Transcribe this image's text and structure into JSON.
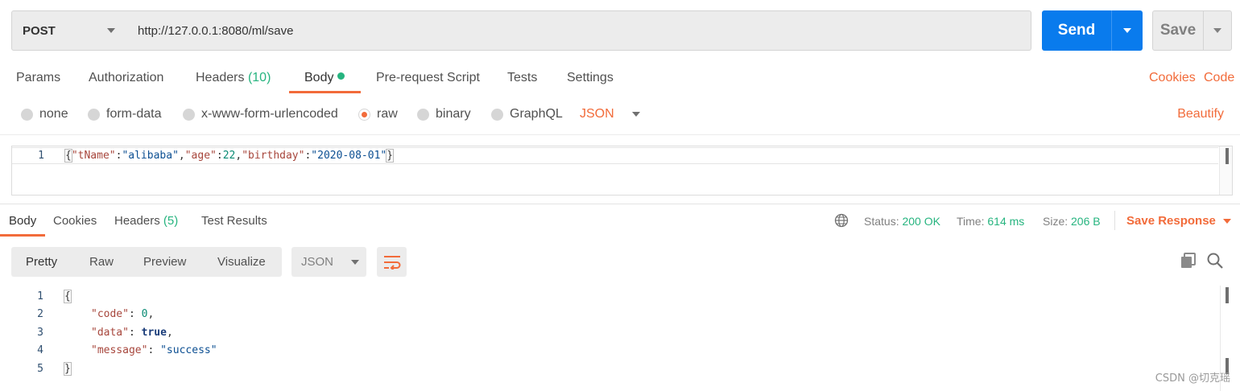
{
  "request": {
    "method": "POST",
    "url": "http://127.0.0.1:8080/ml/save",
    "send_label": "Send",
    "save_label": "Save"
  },
  "request_tabs": {
    "params": "Params",
    "authorization": "Authorization",
    "headers": "Headers",
    "headers_count": "(10)",
    "body": "Body",
    "pre_request": "Pre-request Script",
    "tests": "Tests",
    "settings": "Settings",
    "cookies": "Cookies",
    "code": "Code"
  },
  "body_types": {
    "none": "none",
    "form_data": "form-data",
    "urlencoded": "x-www-form-urlencoded",
    "raw": "raw",
    "binary": "binary",
    "graphql": "GraphQL",
    "selected": "raw",
    "language": "JSON",
    "beautify": "Beautify"
  },
  "request_body": {
    "line_number": "1",
    "tokens": {
      "open": "{",
      "k1": "\"tName\"",
      "c1": ":",
      "v1": "\"alibaba\"",
      "s1": ",",
      "k2": "\"age\"",
      "c2": ":",
      "v2": "22",
      "s2": ",",
      "k3": "\"birthday\"",
      "c3": ":",
      "v3": "\"2020-08-01\"",
      "close": "}"
    }
  },
  "response_tabs": {
    "body": "Body",
    "cookies": "Cookies",
    "headers": "Headers",
    "headers_count": "(5)",
    "test_results": "Test Results"
  },
  "response_meta": {
    "status_label": "Status:",
    "status_value": "200 OK",
    "time_label": "Time:",
    "time_value": "614 ms",
    "size_label": "Size:",
    "size_value": "206 B",
    "save_response": "Save Response"
  },
  "response_toolbar": {
    "pretty": "Pretty",
    "raw": "Raw",
    "preview": "Preview",
    "visualize": "Visualize",
    "format": "JSON"
  },
  "response_body": {
    "line_numbers": [
      "1",
      "2",
      "3",
      "4",
      "5"
    ],
    "open": "{",
    "code_key": "\"code\"",
    "code_val": "0",
    "data_key": "\"data\"",
    "data_val": "true",
    "message_key": "\"message\"",
    "message_val": "\"success\"",
    "colon": ": ",
    "comma": ",",
    "close": "}"
  },
  "watermark": "CSDN @切克瑶",
  "colors": {
    "accent": "#f26b3a",
    "primary": "#097bed",
    "success": "#26b47f"
  }
}
